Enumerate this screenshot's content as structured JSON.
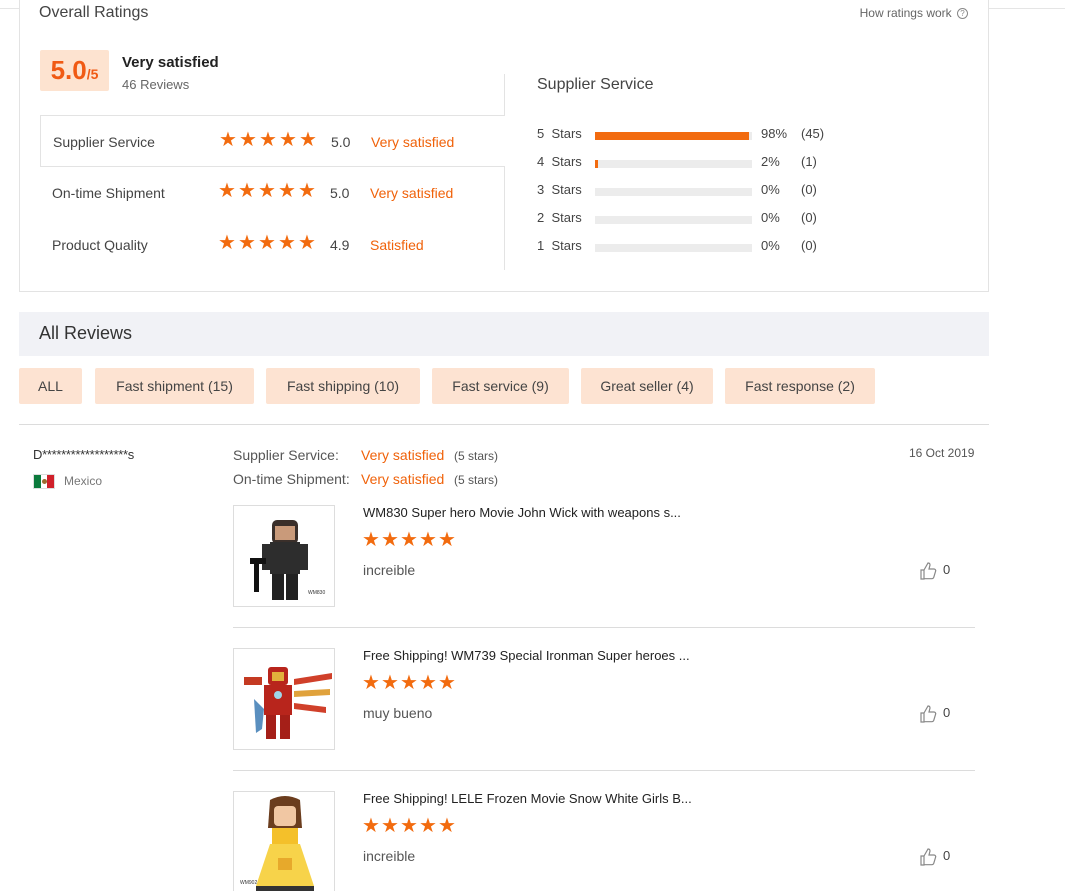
{
  "overall": {
    "title": "Overall Ratings",
    "how_link": "How ratings work",
    "score_big": "5.0",
    "score_small": "/5",
    "label": "Very satisfied",
    "count": "46 Reviews"
  },
  "dimensions": [
    {
      "name": "Supplier Service",
      "score": "5.0",
      "word": "Very satisfied",
      "stars": 5
    },
    {
      "name": "On-time Shipment",
      "score": "5.0",
      "word": "Very satisfied",
      "stars": 5
    },
    {
      "name": "Product Quality",
      "score": "4.9",
      "word": "Satisfied",
      "stars": 5
    }
  ],
  "supplier_service": {
    "title": "Supplier Service",
    "bars": [
      {
        "label": "5  Stars",
        "fraction": 0.98,
        "pct": "98%",
        "count": "(45)"
      },
      {
        "label": "4  Stars",
        "fraction": 0.02,
        "pct": "2%",
        "count": "(1)"
      },
      {
        "label": "3  Stars",
        "fraction": 0,
        "pct": "0%",
        "count": "(0)"
      },
      {
        "label": "2  Stars",
        "fraction": 0,
        "pct": "0%",
        "count": "(0)"
      },
      {
        "label": "1  Stars",
        "fraction": 0,
        "pct": "0%",
        "count": "(0)"
      }
    ]
  },
  "all_reviews": {
    "title": "All Reviews",
    "filters": [
      "ALL",
      "Fast shipment (15)",
      "Fast shipping (10)",
      "Fast service (9)",
      "Great seller (4)",
      "Fast response (2)"
    ]
  },
  "review": {
    "reviewer": "D******************s",
    "country": "Mexico",
    "date": "16 Oct 2019",
    "supplier_label": "Supplier Service:",
    "supplier_word": "Very satisfied",
    "supplier_stars": "(5 stars)",
    "shipment_label": "On-time Shipment:",
    "shipment_word": "Very satisfied",
    "shipment_stars": "(5 stars)",
    "items": [
      {
        "title": "WM830 Super hero Movie John Wick with weapons s...",
        "stars": 5,
        "comment": "increible",
        "likes": "0",
        "thumb_text": "WM830"
      },
      {
        "title": "Free Shipping! WM739 Special Ironman Super heroes ...",
        "stars": 5,
        "comment": "muy bueno",
        "likes": "0"
      },
      {
        "title": "Free Shipping! LELE Frozen Movie Snow White Girls B...",
        "stars": 5,
        "comment": "increible",
        "likes": "0",
        "thumb_text": "WM902"
      }
    ]
  },
  "colors": {
    "accent": "#f26b0f",
    "badge_bg": "#fde3d0",
    "filter_bg": "#fde3d2"
  }
}
